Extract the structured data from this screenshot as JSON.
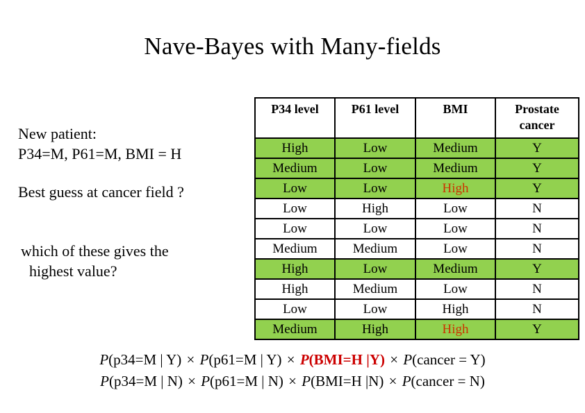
{
  "slide": {
    "title": "Nave-Bayes with Many-fields"
  },
  "left_column": {
    "new_patient_label": "New patient:",
    "new_patient_values": "P34=M,  P61=M,  BMI = H",
    "question": "Best guess at cancer field ?",
    "prompt_line1": "which of these gives the",
    "prompt_line2": "highest value?"
  },
  "table": {
    "headers": [
      {
        "line1": "P34 level",
        "line2": ""
      },
      {
        "line1": "P61 level",
        "line2": ""
      },
      {
        "line1": "BMI",
        "line2": ""
      },
      {
        "line1": "Prostate",
        "line2": "cancer"
      }
    ],
    "rows": [
      {
        "p34": "High",
        "p61": "Low",
        "bmi": "Medium",
        "cancer": "Y",
        "highlight": "green",
        "bmi_red": false
      },
      {
        "p34": "Medium",
        "p61": "Low",
        "bmi": "Medium",
        "cancer": "Y",
        "highlight": "green",
        "bmi_red": false
      },
      {
        "p34": "Low",
        "p61": "Low",
        "bmi": "High",
        "cancer": "Y",
        "highlight": "green",
        "bmi_red": true
      },
      {
        "p34": "Low",
        "p61": "High",
        "bmi": "Low",
        "cancer": "N",
        "highlight": "none",
        "bmi_red": false
      },
      {
        "p34": "Low",
        "p61": "Low",
        "bmi": "Low",
        "cancer": "N",
        "highlight": "none",
        "bmi_red": false
      },
      {
        "p34": "Medium",
        "p61": "Medium",
        "bmi": "Low",
        "cancer": "N",
        "highlight": "none",
        "bmi_red": false
      },
      {
        "p34": "High",
        "p61": "Low",
        "bmi": "Medium",
        "cancer": "Y",
        "highlight": "green",
        "bmi_red": false
      },
      {
        "p34": "High",
        "p61": "Medium",
        "bmi": "Low",
        "cancer": "N",
        "highlight": "none",
        "bmi_red": false
      },
      {
        "p34": "Low",
        "p61": "Low",
        "bmi": "High",
        "cancer": "N",
        "highlight": "none",
        "bmi_red": false
      },
      {
        "p34": "Medium",
        "p61": "High",
        "bmi": "High",
        "cancer": "Y",
        "highlight": "green",
        "bmi_red": true
      }
    ],
    "highlight_color": "#92D14F",
    "red_text_color": "#CC3300"
  },
  "formulas": {
    "line_yes": {
      "t1_p": "P",
      "t1_args": "(p34=M | Y)",
      "op1": "×",
      "t2_p": "P",
      "t2_args": "(p61=M | Y)",
      "op2": "×",
      "t3_p": "P",
      "t3_args": "(BMI=H |Y)",
      "op3": "×",
      "t4_p": "P",
      "t4_args": "(cancer = Y)"
    },
    "line_no": {
      "t1_p": "P",
      "t1_args": "(p34=M | N)",
      "op1": "×",
      "t2_p": "P",
      "t2_args": "(p61=M | N)",
      "op2": "×",
      "t3_p": "P",
      "t3_args": "(BMI=H |N)",
      "op3": "×",
      "t4_p": "P",
      "t4_args": "(cancer = N)"
    },
    "red_color": "#CC0000"
  }
}
